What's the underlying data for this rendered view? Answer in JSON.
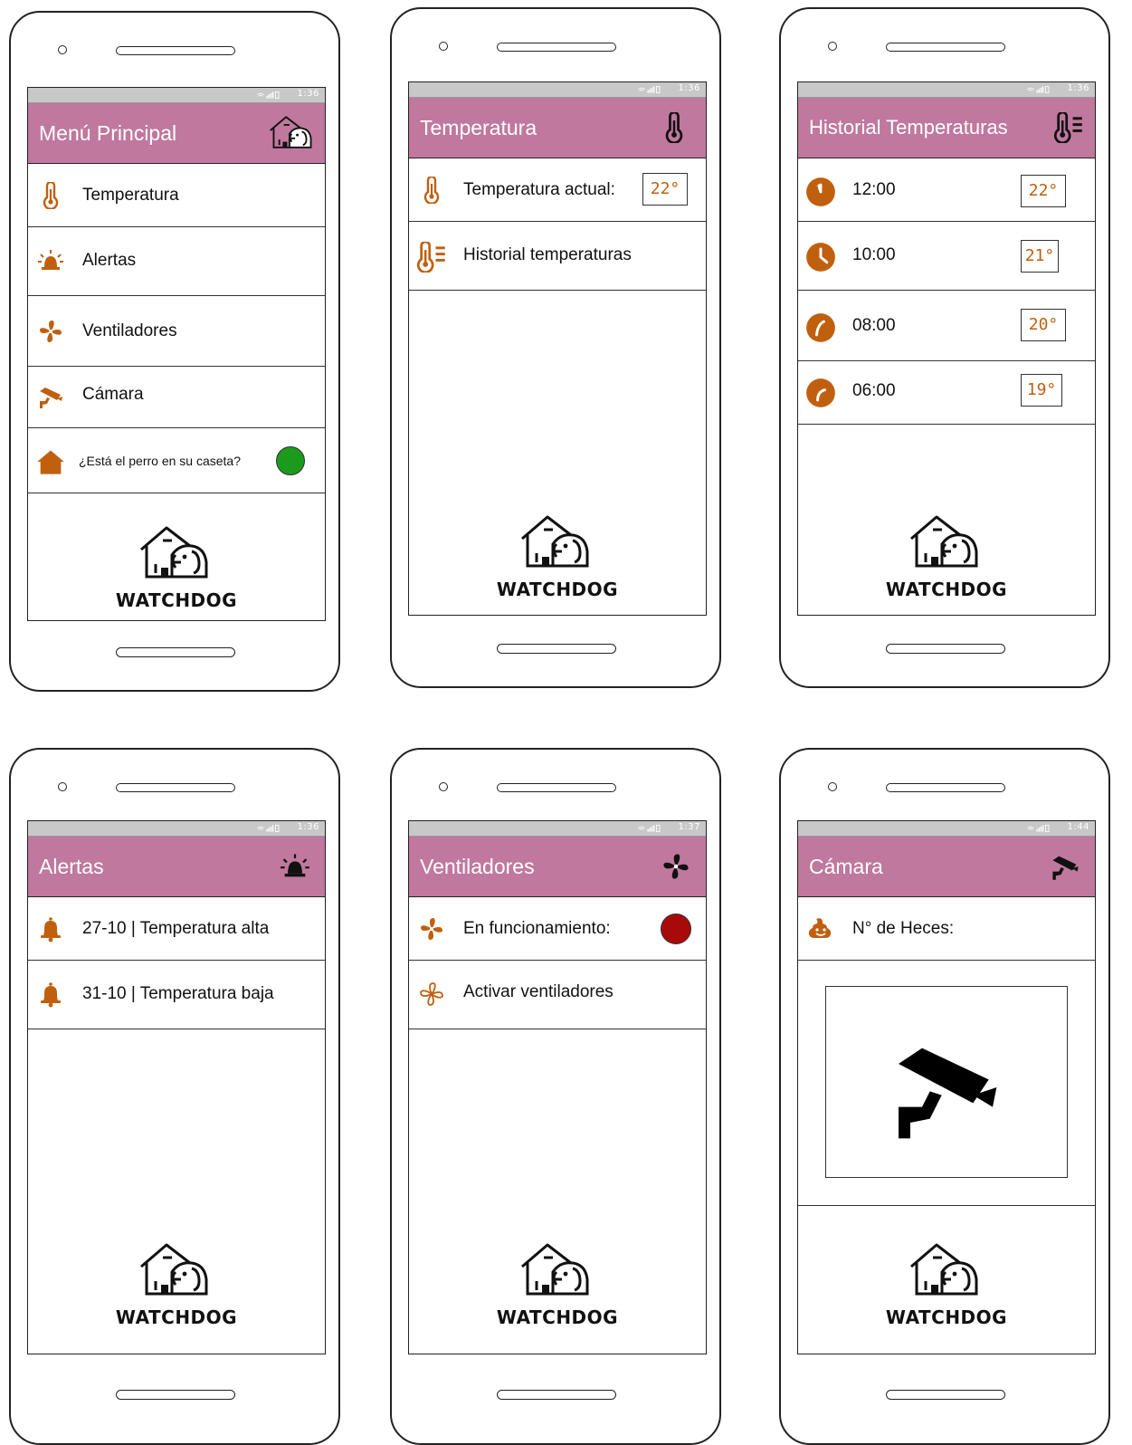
{
  "status_times": {
    "menu": "1:36",
    "temperatura": "1:36",
    "historial": "1:36",
    "alertas": "1:36",
    "ventiladores": "1:37",
    "camara": "1:44"
  },
  "menu": {
    "title": "Menú Principal",
    "items": [
      {
        "label": "Temperatura",
        "icon": "thermometer-icon"
      },
      {
        "label": "Alertas",
        "icon": "alarm-icon"
      },
      {
        "label": "Ventiladores",
        "icon": "fan-icon"
      },
      {
        "label": "Cámara",
        "icon": "security-camera-icon"
      }
    ],
    "dog_question": "¿Está el perro en su caseta?",
    "dog_status_color": "#1c9a1c"
  },
  "temperatura": {
    "title": "Temperatura",
    "current_label": "Temperatura actual:",
    "current_value": "22°",
    "history_label": "Historial temperaturas"
  },
  "historial": {
    "title": "Historial Temperaturas",
    "rows": [
      {
        "time": "12:00",
        "value": "22°"
      },
      {
        "time": "10:00",
        "value": "21°"
      },
      {
        "time": "08:00",
        "value": "20°"
      },
      {
        "time": "06:00",
        "value": "19°"
      }
    ]
  },
  "alertas": {
    "title": "Alertas",
    "items": [
      {
        "text": "27-10  | Temperatura alta"
      },
      {
        "text": "31-10 | Temperatura baja"
      }
    ]
  },
  "ventiladores": {
    "title": "Ventiladores",
    "running_label": "En funcionamiento:",
    "running_status_color": "#a80a0a",
    "activate_label": "Activar ventiladores"
  },
  "camara": {
    "title": "Cámara",
    "heces_label": "N° de Heces:"
  },
  "brand": "WATCHDOG",
  "colors": {
    "accent": "#c0789e",
    "icon": "#c0600f"
  }
}
